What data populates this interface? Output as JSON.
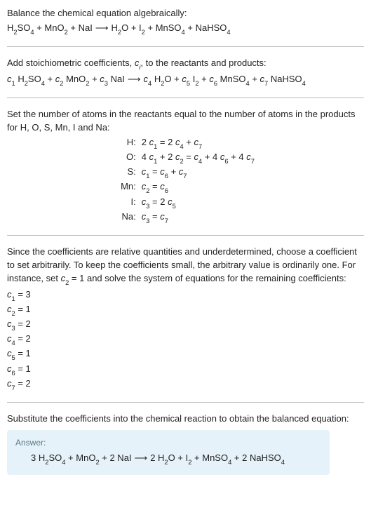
{
  "sec1": {
    "title": "Balance the chemical equation algebraically:",
    "eq_parts": {
      "lhs1a": "H",
      "lhs1b": "2",
      "lhs1c": "SO",
      "lhs1d": "4",
      "plus1": " + ",
      "lhs2a": "MnO",
      "lhs2b": "2",
      "plus2": " + ",
      "lhs3": "NaI",
      "arrow": "⟶",
      "rhs1a": "H",
      "rhs1b": "2",
      "rhs1c": "O",
      "rplus1": " + ",
      "rhs2a": "I",
      "rhs2b": "2",
      "rplus2": " + ",
      "rhs3a": "MnSO",
      "rhs3b": "4",
      "rplus3": " + ",
      "rhs4a": "NaHSO",
      "rhs4b": "4"
    }
  },
  "sec2": {
    "title_a": "Add stoichiometric coefficients, ",
    "title_ci": "c",
    "title_i": "i",
    "title_b": ", to the reactants and products:",
    "eq": {
      "c1": "c",
      "c1i": "1",
      "sp1": " ",
      "r1a": "H",
      "r1b": "2",
      "r1c": "SO",
      "r1d": "4",
      "plus1": " + ",
      "c2": "c",
      "c2i": "2",
      "sp2": " ",
      "r2a": "MnO",
      "r2b": "2",
      "plus2": " + ",
      "c3": "c",
      "c3i": "3",
      "sp3": " ",
      "r3": "NaI",
      "arrow": "⟶",
      "c4": "c",
      "c4i": "4",
      "sp4": " ",
      "p1a": "H",
      "p1b": "2",
      "p1c": "O",
      "rplus1": " + ",
      "c5": "c",
      "c5i": "5",
      "sp5": " ",
      "p2a": "I",
      "p2b": "2",
      "rplus2": " + ",
      "c6": "c",
      "c6i": "6",
      "sp6": " ",
      "p3a": "MnSO",
      "p3b": "4",
      "rplus3": " + ",
      "c7": "c",
      "c7i": "7",
      "sp7": " ",
      "p4a": "NaHSO",
      "p4b": "4"
    }
  },
  "sec3": {
    "intro": "Set the number of atoms in the reactants equal to the number of atoms in the products for H, O, S, Mn, I and Na:",
    "rows": {
      "H_lab": "H:",
      "H_eq_a": "2 ",
      "H_c1": "c",
      "H_c1i": "1",
      "H_eqs": " = 2 ",
      "H_c4": "c",
      "H_c4i": "4",
      "H_plus": " + ",
      "H_c7": "c",
      "H_c7i": "7",
      "O_lab": "O:",
      "O_a": "4 ",
      "O_c1": "c",
      "O_c1i": "1",
      "O_p1": " + 2 ",
      "O_c2": "c",
      "O_c2i": "2",
      "O_eq": " = ",
      "O_c4": "c",
      "O_c4i": "4",
      "O_p2": " + 4 ",
      "O_c6": "c",
      "O_c6i": "6",
      "O_p3": " + 4 ",
      "O_c7": "c",
      "O_c7i": "7",
      "S_lab": "S:",
      "S_c1": "c",
      "S_c1i": "1",
      "S_eq": " = ",
      "S_c6": "c",
      "S_c6i": "6",
      "S_p": " + ",
      "S_c7": "c",
      "S_c7i": "7",
      "Mn_lab": "Mn:",
      "Mn_c2": "c",
      "Mn_c2i": "2",
      "Mn_eq": " = ",
      "Mn_c6": "c",
      "Mn_c6i": "6",
      "I_lab": "I:",
      "I_c3": "c",
      "I_c3i": "3",
      "I_eq": " = 2 ",
      "I_c5": "c",
      "I_c5i": "5",
      "Na_lab": "Na:",
      "Na_c3": "c",
      "Na_c3i": "3",
      "Na_eq": " = ",
      "Na_c7": "c",
      "Na_c7i": "7"
    }
  },
  "sec4": {
    "p1a": "Since the coefficients are relative quantities and underdetermined, choose a coefficient to set arbitrarily. To keep the coefficients small, the arbitrary value is ordinarily one. For instance, set ",
    "p1c": "c",
    "p1ci": "2",
    "p1eq": " = 1",
    "p1b": " and solve the system of equations for the remaining coefficients:",
    "coefs": {
      "l1a": "c",
      "l1b": "1",
      "l1c": " = 3",
      "l2a": "c",
      "l2b": "2",
      "l2c": " = 1",
      "l3a": "c",
      "l3b": "3",
      "l3c": " = 2",
      "l4a": "c",
      "l4b": "4",
      "l4c": " = 2",
      "l5a": "c",
      "l5b": "5",
      "l5c": " = 1",
      "l6a": "c",
      "l6b": "6",
      "l6c": " = 1",
      "l7a": "c",
      "l7b": "7",
      "l7c": " = 2"
    }
  },
  "sec5": {
    "intro": "Substitute the coefficients into the chemical reaction to obtain the balanced equation:",
    "answer_label": "Answer:",
    "eq": {
      "a1": "3 H",
      "a1b": "2",
      "a1c": "SO",
      "a1d": "4",
      "p1": " + ",
      "a2": "MnO",
      "a2b": "2",
      "p2": " + ",
      "a3": "2 NaI",
      "arrow": "⟶",
      "b1": "2 H",
      "b1b": "2",
      "b1c": "O",
      "bp1": " + ",
      "b2": "I",
      "b2b": "2",
      "bp2": " + ",
      "b3": "MnSO",
      "b3b": "4",
      "bp3": " + ",
      "b4": "2 NaHSO",
      "b4b": "4"
    }
  }
}
